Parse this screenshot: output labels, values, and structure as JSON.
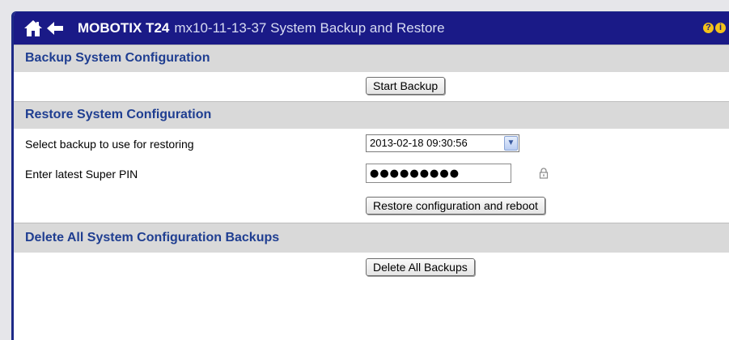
{
  "header": {
    "brand": "MOBOTIX T24",
    "subtitle": "mx10-11-13-37 System Backup and Restore",
    "help_glyph": "?",
    "info_glyph": "i",
    "icons": [
      "home-icon",
      "back-arrow-icon",
      "help-icon",
      "info-icon"
    ],
    "colors": {
      "titlebar": "#1a1a87",
      "section_header_bg": "#d9d9d9",
      "section_title": "#1f3e91",
      "help_badge": "#f3c21a"
    }
  },
  "backup": {
    "title": "Backup System Configuration",
    "start_button": "Start Backup"
  },
  "restore": {
    "title": "Restore System Configuration",
    "select_label": "Select backup to use for restoring",
    "selected_backup": "2013-02-18 09:30:56",
    "pin_label": "Enter latest Super PIN",
    "pin_value": "●●●●●●●●●",
    "lock_icon": "lock-icon",
    "restore_button": "Restore configuration and reboot"
  },
  "delete": {
    "title": "Delete All System Configuration Backups",
    "delete_button": "Delete All Backups"
  }
}
